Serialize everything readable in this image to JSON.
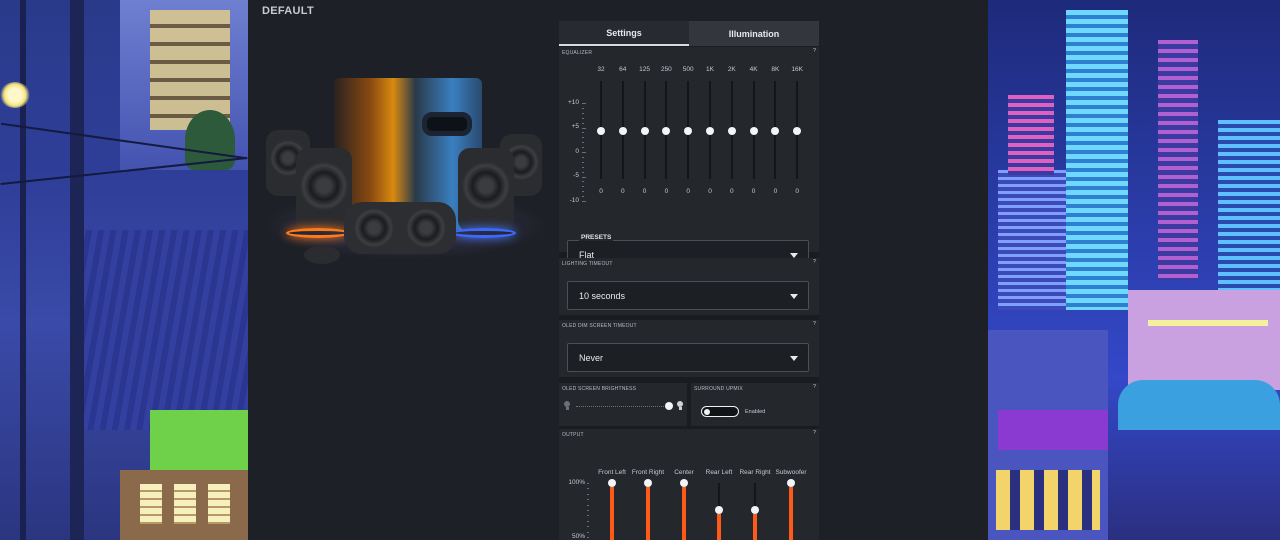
{
  "window": {
    "profile_title": "DEFAULT"
  },
  "tabs": [
    {
      "label": "Settings",
      "active": true
    },
    {
      "label": "Illumination",
      "active": false
    }
  ],
  "equalizer": {
    "label": "EQUALIZER",
    "help": "?",
    "y_labels": [
      "+10",
      "+5",
      "0",
      "-5",
      "-10"
    ],
    "bands": [
      {
        "freq": "32",
        "value": "0"
      },
      {
        "freq": "64",
        "value": "0"
      },
      {
        "freq": "125",
        "value": "0"
      },
      {
        "freq": "250",
        "value": "0"
      },
      {
        "freq": "500",
        "value": "0"
      },
      {
        "freq": "1K",
        "value": "0"
      },
      {
        "freq": "2K",
        "value": "0"
      },
      {
        "freq": "4K",
        "value": "0"
      },
      {
        "freq": "8K",
        "value": "0"
      },
      {
        "freq": "16K",
        "value": "0"
      }
    ],
    "presets_label": "PRESETS",
    "preset_value": "Flat"
  },
  "lighting_timeout": {
    "label": "LIGHTING TIMEOUT",
    "help": "?",
    "value": "10 seconds"
  },
  "oled_dim": {
    "label": "OLED DIM SCREEN TIMEOUT",
    "help": "?",
    "value": "Never"
  },
  "oled_brightness": {
    "label": "OLED SCREEN BRIGHTNESS",
    "level": 1.0
  },
  "surround_upmix": {
    "label": "SURROUND UPMIX",
    "help": "?",
    "state_label": "Enabled",
    "enabled": false
  },
  "output": {
    "label": "OUTPUT",
    "help": "?",
    "y_labels": [
      "100%",
      "50%"
    ],
    "channels": [
      {
        "name": "Front Left",
        "level": 100
      },
      {
        "name": "Front Right",
        "level": 100
      },
      {
        "name": "Center",
        "level": 100
      },
      {
        "name": "Rear Left",
        "level": 75
      },
      {
        "name": "Rear Right",
        "level": 75
      },
      {
        "name": "Subwoofer",
        "level": 100
      }
    ],
    "accent": "#ff5a1a"
  },
  "colors": {
    "panel_bg": "#24272c",
    "app_bg": "#1d2026",
    "knob": "#f4f5f7"
  }
}
